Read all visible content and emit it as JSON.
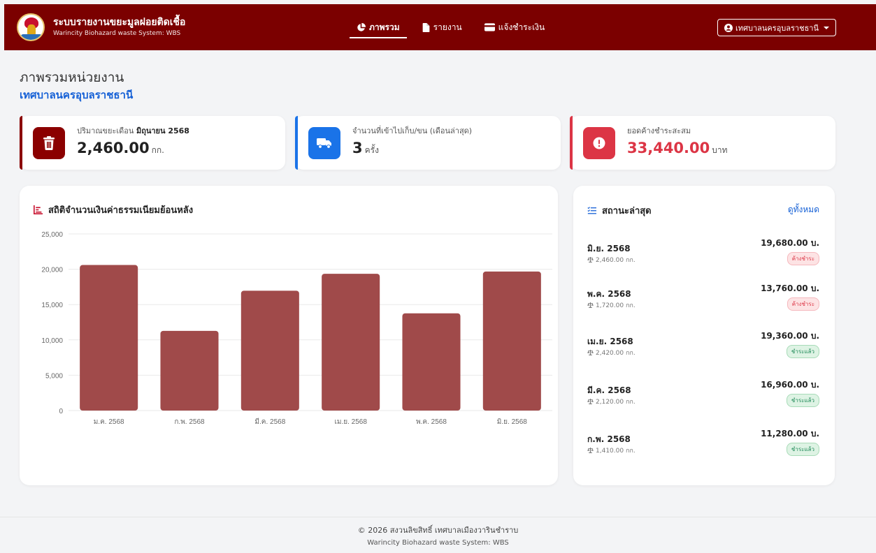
{
  "app": {
    "title": "ระบบรายงานขยะมูลฝอยติดเชื้อ",
    "subtitle": "Warincity Biohazard waste System: WBS"
  },
  "nav": {
    "items": [
      {
        "label": "ภาพรวม",
        "icon": "pie-chart-icon",
        "active": true
      },
      {
        "label": "รายงาน",
        "icon": "file-icon",
        "active": false
      },
      {
        "label": "แจ้งชำระเงิน",
        "icon": "credit-card-icon",
        "active": false
      }
    ],
    "user": "เทศบาลนครอุบลราชธานี"
  },
  "page": {
    "title": "ภาพรวมหน่วยงาน",
    "subtitle": "เทศบาลนครอุบลราชธานี"
  },
  "stats": [
    {
      "label_prefix": "ปริมาณขยะเดือน",
      "label_bold": "มิถุนายน 2568",
      "value": "2,460.00",
      "unit": "กก.",
      "icon": "trash-icon",
      "accent": "#8b0000",
      "value_color": "#222222"
    },
    {
      "label_prefix": "จำนวนที่เข้าไปเก็บ/ขน (เดือนล่าสุด)",
      "label_bold": "",
      "value": "3",
      "unit": "ครั้ง",
      "icon": "truck-icon",
      "accent": "#1a73e8",
      "value_color": "#222222"
    },
    {
      "label_prefix": "ยอดค้างชำระสะสม",
      "label_bold": "",
      "value": "33,440.00",
      "unit": "บาท",
      "icon": "alert-icon",
      "accent": "#dc3545",
      "value_color": "#dc3545"
    }
  ],
  "chart": {
    "title": "สถิติจำนวนเงินค่าธรรมเนียมย้อนหลัง"
  },
  "chart_data": {
    "type": "bar",
    "categories": [
      "ม.ค. 2568",
      "ก.พ. 2568",
      "มี.ค. 2568",
      "เม.ย. 2568",
      "พ.ค. 2568",
      "มิ.ย. 2568"
    ],
    "values": [
      20600,
      11280,
      16960,
      19360,
      13760,
      19680
    ],
    "title": "สถิติจำนวนเงินค่าธรรมเนียมย้อนหลัง",
    "xlabel": "",
    "ylabel": "",
    "ylim": [
      0,
      25000
    ],
    "yticks": [
      0,
      5000,
      10000,
      15000,
      20000,
      25000
    ],
    "ytick_labels": [
      "0",
      "5,000",
      "10,000",
      "15,000",
      "20,000",
      "25,000"
    ],
    "grid": true,
    "legend": "none",
    "bar_color": "#a04a4a"
  },
  "status": {
    "title": "สถานะล่าสุด",
    "view_all": "ดูทั้งหมด",
    "items": [
      {
        "month": "มิ.ย. 2568",
        "weight": "2,460.00 กก.",
        "amount": "19,680.00 บ.",
        "badge": "ค้างชำระ",
        "paid": false
      },
      {
        "month": "พ.ค. 2568",
        "weight": "1,720.00 กก.",
        "amount": "13,760.00 บ.",
        "badge": "ค้างชำระ",
        "paid": false
      },
      {
        "month": "เม.ย. 2568",
        "weight": "2,420.00 กก.",
        "amount": "19,360.00 บ.",
        "badge": "ชำระแล้ว",
        "paid": true
      },
      {
        "month": "มี.ค. 2568",
        "weight": "2,120.00 กก.",
        "amount": "16,960.00 บ.",
        "badge": "ชำระแล้ว",
        "paid": true
      },
      {
        "month": "ก.พ. 2568",
        "weight": "1,410.00 กก.",
        "amount": "11,280.00 บ.",
        "badge": "ชำระแล้ว",
        "paid": true
      }
    ]
  },
  "footer": {
    "copyright": "© 2026 สงวนลิขสิทธิ์ เทศบาลเมืองวารินชำราบ",
    "system": "Warincity Biohazard waste System: WBS"
  }
}
